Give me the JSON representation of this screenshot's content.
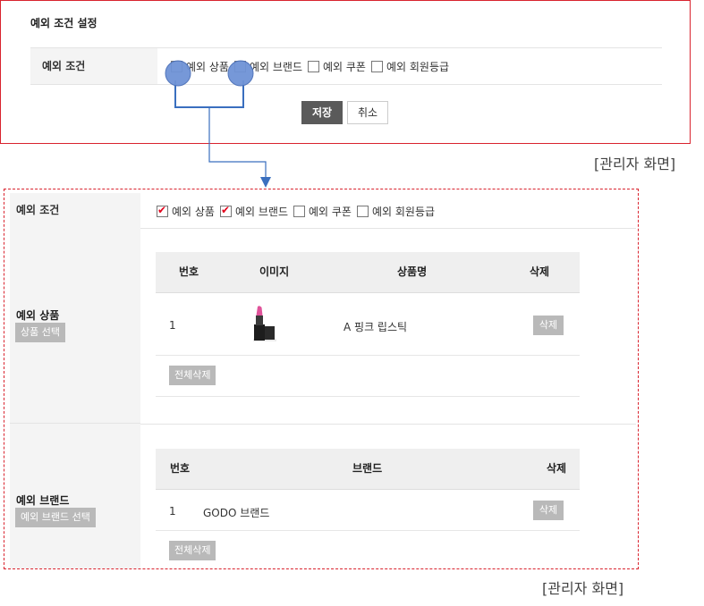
{
  "top": {
    "title": "예외 조건 설정",
    "condition_label": "예외 조건",
    "options": [
      {
        "label": "예외 상품",
        "checked": false
      },
      {
        "label": "예외 브랜드",
        "checked": false
      },
      {
        "label": "예외 쿠폰",
        "checked": false
      },
      {
        "label": "예외 회원등급",
        "checked": false
      }
    ],
    "save_label": "저장",
    "cancel_label": "취소"
  },
  "captions": {
    "top": "[관리자 화면]",
    "bottom": "[관리자 화면]"
  },
  "bottom": {
    "condition_label": "예외 조건",
    "options": [
      {
        "label": "예외 상품",
        "checked": true
      },
      {
        "label": "예외 브랜드",
        "checked": true
      },
      {
        "label": "예외 쿠폰",
        "checked": false
      },
      {
        "label": "예외 회원등급",
        "checked": false
      }
    ],
    "product": {
      "title": "예외 상품",
      "select_button": "상품 선택",
      "headers": {
        "no": "번호",
        "image": "이미지",
        "name": "상품명",
        "delete": "삭제"
      },
      "rows": [
        {
          "no": "1",
          "name": "A 핑크 립스틱",
          "delete": "삭제"
        }
      ],
      "delete_all": "전체삭제"
    },
    "brand": {
      "title": "예외 브랜드",
      "select_button": "예외 브랜드 선택",
      "headers": {
        "no": "번호",
        "brand": "브랜드",
        "delete": "삭제"
      },
      "rows": [
        {
          "no": "1",
          "brand": "GODO 브랜드",
          "delete": "삭제"
        }
      ],
      "delete_all": "전체삭제"
    }
  },
  "colors": {
    "accent_red": "#d9232e",
    "connector_blue": "#3a6fbf",
    "marker_fill": "#6f93d6"
  }
}
